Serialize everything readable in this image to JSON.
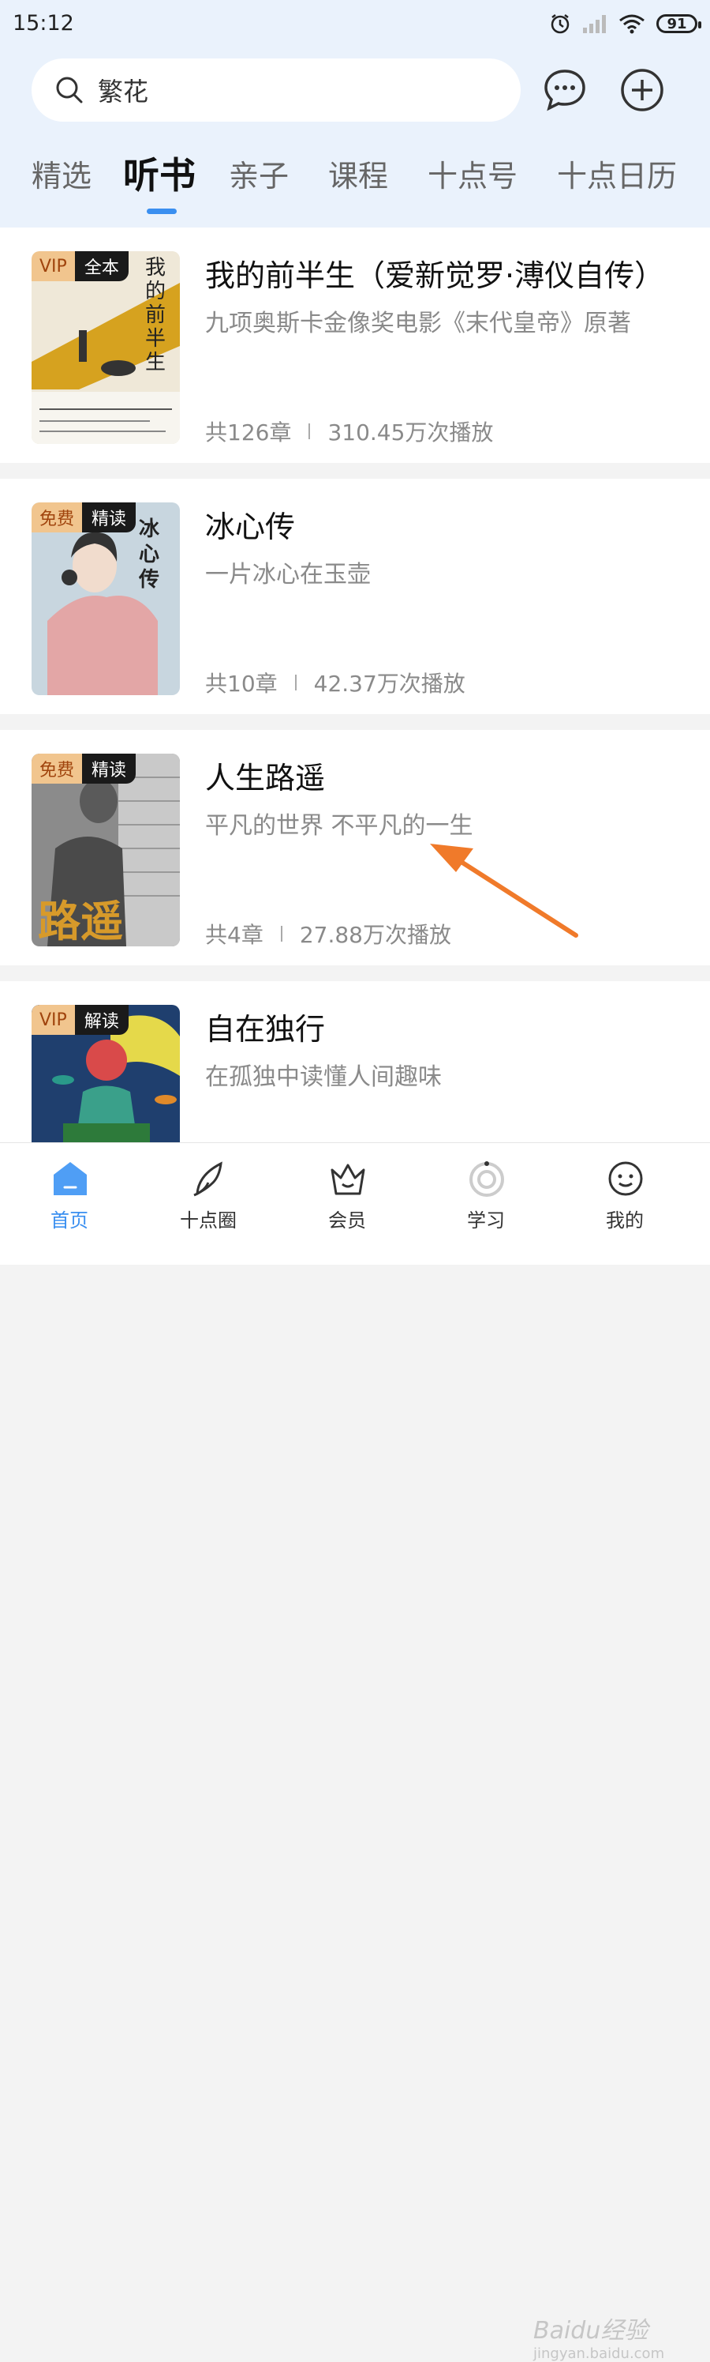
{
  "status_bar": {
    "time": "15:12",
    "battery": "91"
  },
  "search": {
    "text": "繁花"
  },
  "tabs": [
    {
      "label": "精选"
    },
    {
      "label": "听书"
    },
    {
      "label": "亲子"
    },
    {
      "label": "课程"
    },
    {
      "label": "十点号"
    },
    {
      "label": "十点日历"
    }
  ],
  "active_tab": "听书",
  "books": [
    {
      "badge_left": "VIP",
      "badge_right": "全本",
      "title": "我的前半生（爱新觉罗·溥仪自传）",
      "subtitle": "九项奥斯卡金像奖电影《末代皇帝》原著",
      "chapters": "共126章",
      "plays": "310.45万次播放",
      "cover_text": "我的前半生"
    },
    {
      "badge_left": "免费",
      "badge_right": "精读",
      "title": "冰心传",
      "subtitle": "一片冰心在玉壶",
      "chapters": "共10章",
      "plays": "42.37万次播放",
      "cover_text": "冰心传"
    },
    {
      "badge_left": "免费",
      "badge_right": "精读",
      "title": "人生路遥",
      "subtitle": "平凡的世界 不平凡的一生",
      "chapters": "共4章",
      "plays": "27.88万次播放",
      "cover_text": "路遥"
    },
    {
      "badge_left": "VIP",
      "badge_right": "解读",
      "title": "自在独行",
      "subtitle": "在孤独中读懂人间趣味",
      "chapters": "",
      "plays": ""
    }
  ],
  "bottom_nav": [
    {
      "label": "首页",
      "icon": "home-icon",
      "active": true
    },
    {
      "label": "十点圈",
      "icon": "feather-icon"
    },
    {
      "label": "会员",
      "icon": "crown-icon"
    },
    {
      "label": "学习",
      "icon": "study-icon"
    },
    {
      "label": "我的",
      "icon": "profile-icon"
    }
  ],
  "watermark": {
    "text": "Baidu经验",
    "sub": "jingyan.baidu.com"
  },
  "colors": {
    "accent": "#3a8ff0",
    "annotation_arrow": "#f07a2a",
    "header_bg": "#eaf2fc"
  }
}
